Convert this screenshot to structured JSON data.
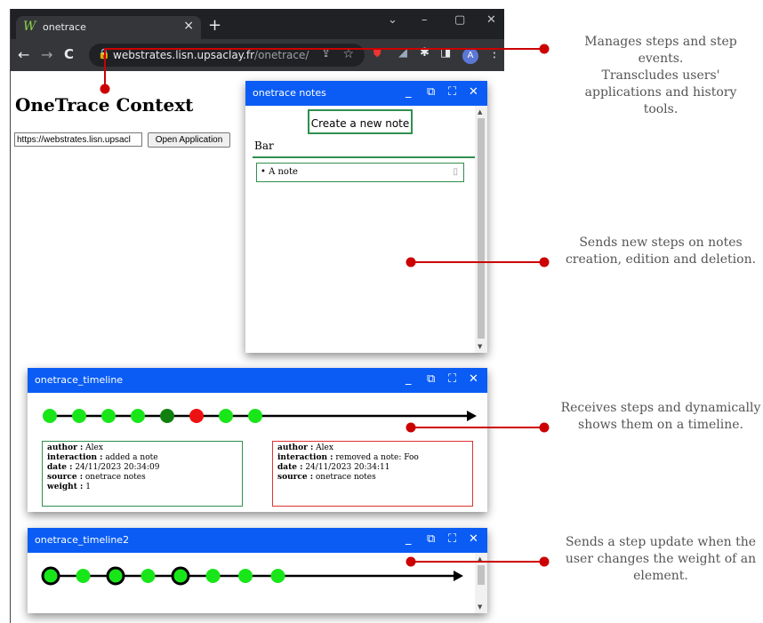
{
  "browser": {
    "tab_title": "onetrace",
    "tab_favicon": "W",
    "url_host": "webstrates.lisn.upsaclay.fr",
    "url_path": "/onetrace/",
    "avatar_letter": "A"
  },
  "page": {
    "title": "OneTrace Context",
    "url_input_value": "https://webstrates.lisn.upsacl",
    "open_button": "Open Application"
  },
  "notes_panel": {
    "title": "onetrace notes",
    "create_button": "Create a new note",
    "note_title": "Bar",
    "items": [
      "• A note"
    ]
  },
  "timeline1": {
    "title": "onetrace_timeline",
    "node_colors": [
      "#19e619",
      "#19e619",
      "#19e619",
      "#19e619",
      "#118011",
      "#ee1111",
      "#19e619",
      "#19e619"
    ],
    "cards": [
      {
        "author_k": "author :",
        "author": " Alex",
        "interaction_k": "interaction :",
        "interaction": " added a note",
        "date_k": "date :",
        "date": " 24/11/2023 20:34:09",
        "source_k": "source :",
        "source": " onetrace notes",
        "weight_k": "weight :",
        "weight": " 1"
      },
      {
        "author_k": "author :",
        "author": " Alex",
        "interaction_k": "interaction :",
        "interaction": " removed a note: Foo",
        "date_k": "date :",
        "date": " 24/11/2023 20:34:11",
        "source_k": "source :",
        "source": " onetrace notes"
      }
    ]
  },
  "timeline2": {
    "title": "onetrace_timeline2",
    "node_big": [
      true,
      false,
      true,
      false,
      true,
      false,
      false,
      false
    ]
  },
  "annotations": [
    "Manages steps and step events.",
    "Transcludes users' applications and history tools.",
    "Sends new steps on notes creation, edition and deletion.",
    "Receives steps and dynamically shows them on a timeline.",
    "Sends a step update when the user changes the weight of an element."
  ],
  "colors": {
    "accent": "#0a5cf5",
    "annotation_red": "#cc0000",
    "note_green": "#2f8f4e"
  }
}
